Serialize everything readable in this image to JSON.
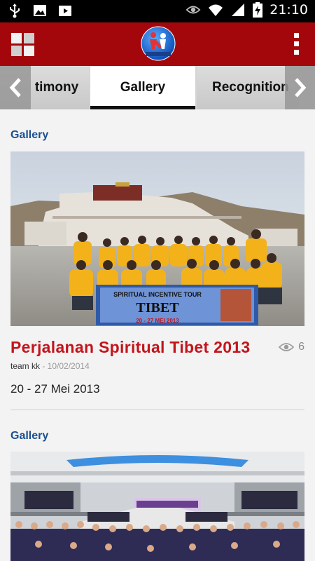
{
  "status_bar": {
    "time": "21:10",
    "icons": [
      "usb-icon",
      "image-icon",
      "play-store-icon",
      "eye-icon",
      "wifi-icon",
      "signal-icon",
      "battery-charging-icon"
    ]
  },
  "app_bar": {
    "menu_icon": "grid-menu-icon",
    "logo_icon": "kk-logo-icon",
    "overflow_icon": "more-vert-icon",
    "brand_color": "#a3070c"
  },
  "tabs": {
    "items": [
      {
        "label": "timony",
        "selected": false
      },
      {
        "label": "Gallery",
        "selected": true
      },
      {
        "label": "Recognition",
        "selected": false
      }
    ]
  },
  "posts": [
    {
      "section": "Gallery",
      "title": "Perjalanan Spiritual Tibet 2013",
      "views": "6",
      "author": "team kk",
      "date": " - 10/02/2014",
      "excerpt": "20 - 27 Mei 2013",
      "banner": {
        "line1": "SPIRITUAL INCENTIVE TOUR",
        "line2": "TIBET",
        "line3": "20 - 27 MEI 2013"
      }
    },
    {
      "section": "Gallery"
    }
  ],
  "colors": {
    "title_red": "#c3141c",
    "section_blue": "#1a4f8f"
  }
}
